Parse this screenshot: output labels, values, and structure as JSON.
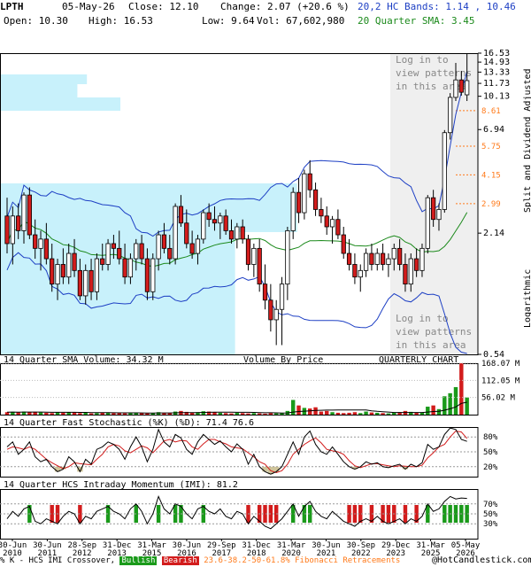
{
  "header": {
    "symbol": "LPTH",
    "date": "05-May-26",
    "close": "Close: 12.10",
    "change": "Change: 2.07 (+20.6 %)",
    "open": "Open: 10.30",
    "high": "High: 16.53",
    "low": "Low: 9.64",
    "volume": "Vol: 67,602,980",
    "bands": "20,2 HC Bands: 1.14 , 10.46",
    "sma": "20 Quarter SMA: 3.45"
  },
  "colors": {
    "up": "#1a9a1a",
    "down": "#d21c1c",
    "band": "#1d3fc4",
    "sma": "#1c8a1c",
    "vbp": "#c8f1fb",
    "fib": "#ff7a1a",
    "stoch_k": "#000000",
    "stoch_d": "#d21c1c",
    "hatch": "#cfc49a"
  },
  "chart_data": [
    {
      "type": "candlestick",
      "title": "",
      "y_scale": "log",
      "ylabel": "Split and Dividend Adjusted",
      "ylabel_right2": "Logarithmic",
      "ylim": [
        0.54,
        16.53
      ],
      "y_ticks": [
        "16.53",
        "14.93",
        "13.33",
        "11.73",
        "10.13",
        "6.94",
        "2.14",
        "0.54"
      ],
      "fib_levels": [
        {
          "label": "8.61",
          "value": 8.61
        },
        {
          "label": "5.75",
          "value": 5.75
        },
        {
          "label": "4.15",
          "value": 4.15
        },
        {
          "label": "2.99",
          "value": 2.99
        }
      ],
      "annotations": [
        "Log in to view patterns in this area",
        "Log in to view patterns in this area"
      ],
      "x_ticks": [
        "30-Jun 2010",
        "30-Jun 2011",
        "28-Sep 2012",
        "31-Dec 2013",
        "31-Mar 2015",
        "30-Jun 2016",
        "29-Sep 2017",
        "31-Dec 2018",
        "31-Mar 2020",
        "30-Jun 2021",
        "30-Sep 2022",
        "29-Dec 2023",
        "31-Mar 2025",
        "05-May 2026"
      ],
      "candles": [
        [
          2.6,
          3.2,
          1.7,
          1.9
        ],
        [
          1.9,
          2.9,
          1.5,
          2.6
        ],
        [
          2.6,
          3.0,
          2.0,
          2.2
        ],
        [
          2.2,
          3.4,
          1.9,
          3.3
        ],
        [
          3.3,
          3.6,
          2.0,
          2.1
        ],
        [
          2.1,
          2.5,
          1.6,
          1.8
        ],
        [
          1.8,
          2.2,
          1.4,
          2.0
        ],
        [
          2.0,
          2.4,
          1.5,
          1.6
        ],
        [
          1.6,
          1.9,
          1.1,
          1.2
        ],
        [
          1.2,
          1.6,
          1.0,
          1.5
        ],
        [
          1.5,
          1.8,
          1.2,
          1.3
        ],
        [
          1.3,
          1.9,
          1.2,
          1.7
        ],
        [
          1.7,
          2.0,
          1.3,
          1.4
        ],
        [
          1.4,
          1.6,
          1.0,
          1.05
        ],
        [
          1.05,
          1.5,
          0.95,
          1.4
        ],
        [
          1.4,
          1.6,
          1.0,
          1.1
        ],
        [
          1.1,
          1.7,
          1.0,
          1.6
        ],
        [
          1.6,
          1.9,
          1.4,
          1.5
        ],
        [
          1.5,
          2.0,
          1.4,
          1.9
        ],
        [
          1.9,
          2.1,
          1.6,
          1.8
        ],
        [
          1.8,
          2.2,
          1.5,
          1.6
        ],
        [
          1.6,
          1.9,
          1.2,
          1.3
        ],
        [
          1.3,
          1.7,
          1.2,
          1.6
        ],
        [
          1.6,
          2.0,
          1.4,
          1.9
        ],
        [
          1.9,
          2.1,
          1.5,
          1.6
        ],
        [
          1.6,
          1.8,
          1.0,
          1.1
        ],
        [
          1.1,
          1.7,
          1.0,
          1.6
        ],
        [
          1.6,
          2.2,
          1.4,
          2.1
        ],
        [
          2.1,
          2.4,
          1.7,
          1.8
        ],
        [
          1.8,
          2.1,
          1.5,
          1.6
        ],
        [
          1.6,
          3.0,
          1.5,
          2.9
        ],
        [
          2.9,
          3.3,
          2.3,
          2.4
        ],
        [
          2.4,
          2.8,
          1.8,
          1.9
        ],
        [
          1.9,
          2.2,
          1.6,
          1.7
        ],
        [
          1.7,
          2.1,
          1.5,
          2.0
        ],
        [
          2.0,
          2.8,
          1.9,
          2.7
        ],
        [
          2.7,
          3.0,
          2.3,
          2.5
        ],
        [
          2.5,
          2.9,
          2.2,
          2.4
        ],
        [
          2.4,
          2.7,
          2.0,
          2.6
        ],
        [
          2.6,
          2.8,
          2.1,
          2.2
        ],
        [
          2.2,
          2.5,
          1.9,
          2.0
        ],
        [
          2.0,
          2.4,
          1.8,
          2.3
        ],
        [
          2.3,
          2.5,
          1.9,
          2.0
        ],
        [
          2.0,
          2.1,
          1.4,
          1.5
        ],
        [
          1.5,
          1.9,
          1.3,
          1.8
        ],
        [
          1.8,
          2.0,
          1.1,
          1.2
        ],
        [
          1.2,
          1.5,
          0.9,
          1.0
        ],
        [
          1.0,
          1.2,
          0.7,
          0.8
        ],
        [
          0.8,
          1.0,
          0.6,
          0.9
        ],
        [
          0.9,
          1.3,
          0.6,
          1.2
        ],
        [
          1.2,
          2.3,
          1.0,
          2.2
        ],
        [
          2.2,
          3.6,
          2.0,
          3.4
        ],
        [
          3.4,
          4.0,
          2.4,
          2.7
        ],
        [
          2.7,
          4.4,
          2.5,
          4.2
        ],
        [
          4.2,
          4.9,
          3.2,
          3.5
        ],
        [
          3.5,
          3.8,
          2.6,
          2.8
        ],
        [
          2.8,
          3.2,
          2.4,
          2.6
        ],
        [
          2.6,
          2.9,
          2.1,
          2.3
        ],
        [
          2.3,
          2.6,
          1.9,
          2.5
        ],
        [
          2.5,
          2.8,
          2.0,
          2.1
        ],
        [
          2.1,
          2.3,
          1.6,
          1.7
        ],
        [
          1.7,
          2.0,
          1.4,
          1.5
        ],
        [
          1.5,
          1.7,
          1.2,
          1.3
        ],
        [
          1.3,
          1.5,
          1.1,
          1.4
        ],
        [
          1.4,
          1.8,
          1.3,
          1.7
        ],
        [
          1.7,
          1.9,
          1.4,
          1.5
        ],
        [
          1.5,
          1.8,
          1.4,
          1.7
        ],
        [
          1.7,
          1.9,
          1.4,
          1.5
        ],
        [
          1.5,
          1.7,
          1.3,
          1.6
        ],
        [
          1.6,
          1.9,
          1.4,
          1.8
        ],
        [
          1.8,
          2.0,
          1.4,
          1.5
        ],
        [
          1.5,
          1.7,
          1.1,
          1.2
        ],
        [
          1.2,
          1.7,
          1.1,
          1.6
        ],
        [
          1.6,
          1.8,
          1.3,
          1.4
        ],
        [
          1.4,
          1.9,
          1.3,
          1.8
        ],
        [
          1.8,
          3.3,
          1.7,
          3.2
        ],
        [
          3.2,
          3.5,
          2.3,
          2.5
        ],
        [
          2.5,
          3.0,
          2.2,
          2.8
        ],
        [
          2.8,
          6.9,
          2.7,
          6.7
        ],
        [
          6.7,
          10.5,
          6.2,
          10.0
        ],
        [
          10.0,
          14.8,
          9.6,
          12.2
        ],
        [
          12.2,
          13.5,
          10.2,
          10.6
        ],
        [
          10.3,
          16.5,
          9.6,
          12.1
        ]
      ],
      "volume_panel": {
        "title": "14 Quarter SMA Volume: 34.32 M",
        "center_label": "Volume By Price",
        "right_label": "QUARTERLY CHART",
        "y_ticks": [
          "168.07 M",
          "112.05 M",
          "56.02 M"
        ],
        "ylim": [
          0,
          168.07
        ],
        "values": [
          8,
          9,
          7,
          10,
          8,
          9,
          7,
          6,
          5,
          7,
          6,
          8,
          7,
          5,
          6,
          4,
          5,
          6,
          7,
          5,
          6,
          4,
          5,
          6,
          5,
          4,
          5,
          8,
          6,
          5,
          10,
          12,
          9,
          7,
          8,
          11,
          10,
          8,
          6,
          5,
          4,
          6,
          5,
          4,
          5,
          4,
          3,
          5,
          4,
          6,
          12,
          48,
          30,
          22,
          20,
          24,
          10,
          12,
          8,
          6,
          5,
          6,
          8,
          5,
          10,
          7,
          6,
          5,
          4,
          6,
          8,
          12,
          9,
          7,
          6,
          26,
          30,
          18,
          60,
          70,
          90,
          168,
          56
        ]
      },
      "stochastic_panel": {
        "title": "14 Quarter Fast Stochastic (%K) (%D): 71.4  76.6",
        "k_label": "%K",
        "d_label": "%D",
        "y_ticks": [
          "80%",
          "50%",
          "20%"
        ],
        "ylim": [
          0,
          100
        ],
        "k": [
          60,
          70,
          45,
          55,
          70,
          40,
          30,
          35,
          20,
          10,
          15,
          40,
          30,
          10,
          35,
          25,
          55,
          60,
          70,
          65,
          55,
          35,
          60,
          80,
          60,
          30,
          55,
          95,
          70,
          60,
          85,
          78,
          55,
          45,
          70,
          85,
          75,
          65,
          72,
          60,
          50,
          66,
          55,
          25,
          45,
          20,
          10,
          5,
          10,
          20,
          45,
          70,
          45,
          80,
          92,
          65,
          50,
          45,
          60,
          45,
          30,
          20,
          15,
          20,
          30,
          25,
          28,
          20,
          18,
          22,
          25,
          15,
          25,
          20,
          28,
          65,
          55,
          60,
          85,
          98,
          95,
          75,
          71
        ],
        "d": [
          55,
          60,
          58,
          55,
          60,
          55,
          45,
          35,
          28,
          22,
          16,
          20,
          28,
          26,
          25,
          24,
          35,
          45,
          60,
          65,
          62,
          52,
          48,
          55,
          62,
          58,
          48,
          60,
          72,
          75,
          70,
          73,
          72,
          60,
          55,
          66,
          75,
          75,
          70,
          66,
          60,
          58,
          56,
          48,
          40,
          30,
          25,
          12,
          8,
          12,
          25,
          45,
          55,
          65,
          72,
          78,
          68,
          55,
          52,
          50,
          45,
          32,
          22,
          18,
          22,
          26,
          26,
          24,
          22,
          20,
          22,
          21,
          20,
          20,
          23,
          38,
          48,
          60,
          65,
          80,
          92,
          90,
          77
        ]
      },
      "momentum_panel": {
        "title": "14 Quarter HCS Intraday Momentum (IMI): 81.2",
        "y_ticks": [
          "70%",
          "50%",
          "30%"
        ],
        "ylim": [
          0,
          100
        ],
        "values": [
          40,
          55,
          45,
          60,
          65,
          35,
          30,
          40,
          35,
          30,
          45,
          55,
          50,
          30,
          45,
          40,
          55,
          60,
          65,
          55,
          50,
          40,
          60,
          70,
          55,
          30,
          50,
          85,
          60,
          50,
          70,
          65,
          50,
          40,
          60,
          65,
          55,
          50,
          60,
          45,
          40,
          55,
          50,
          30,
          45,
          35,
          25,
          20,
          30,
          40,
          55,
          70,
          45,
          65,
          75,
          55,
          45,
          40,
          55,
          45,
          35,
          30,
          25,
          35,
          40,
          35,
          45,
          35,
          30,
          35,
          40,
          30,
          40,
          35,
          45,
          70,
          55,
          60,
          75,
          85,
          80,
          82,
          81
        ]
      },
      "footer_legend": {
        "prefix": "% K - HCS IMI Crossover,",
        "bullish": "Bullish",
        "bearish": "Bearish",
        "fib_text": "23.6-38.2-50-61.8% Fibonacci Retracements",
        "copyright": "@HotCandlestick.com"
      }
    }
  ]
}
